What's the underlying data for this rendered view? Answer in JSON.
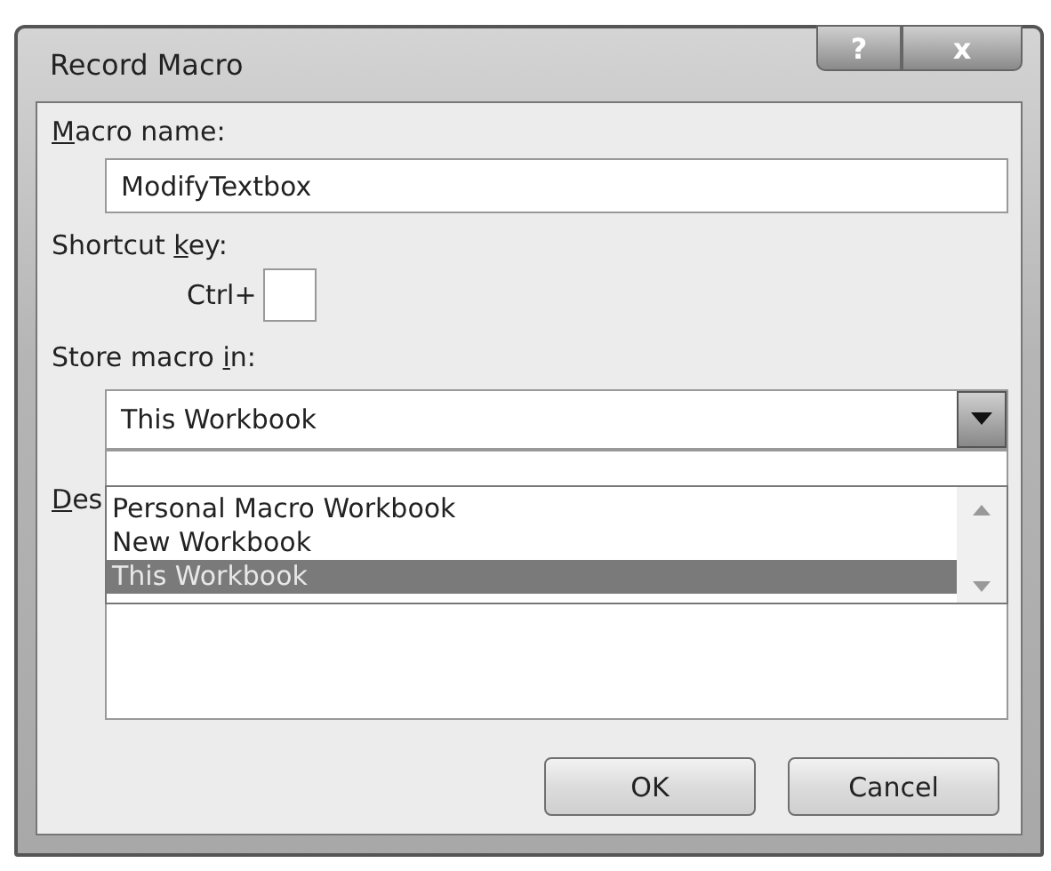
{
  "window": {
    "title": "Record Macro",
    "help_button": "?",
    "close_button": "x"
  },
  "macro_name": {
    "label": {
      "key": "M",
      "post": "acro name:"
    },
    "value": "ModifyTextbox"
  },
  "shortcut_key": {
    "label": {
      "pre": "Shortcut ",
      "key": "k",
      "post": "ey:"
    },
    "prefix": "Ctrl+"
  },
  "store_macro_in": {
    "label": {
      "pre": "Store macro ",
      "key": "i",
      "post": "n:"
    },
    "value": "This Workbook",
    "expanded": true,
    "options": [
      {
        "label": "Personal Macro Workbook",
        "selected": false
      },
      {
        "label": "New Workbook",
        "selected": false
      },
      {
        "label": "This Workbook",
        "selected": true
      }
    ]
  },
  "description": {
    "label": {
      "key": "D",
      "post": "es"
    }
  },
  "buttons": [
    "OK",
    "Cancel"
  ]
}
